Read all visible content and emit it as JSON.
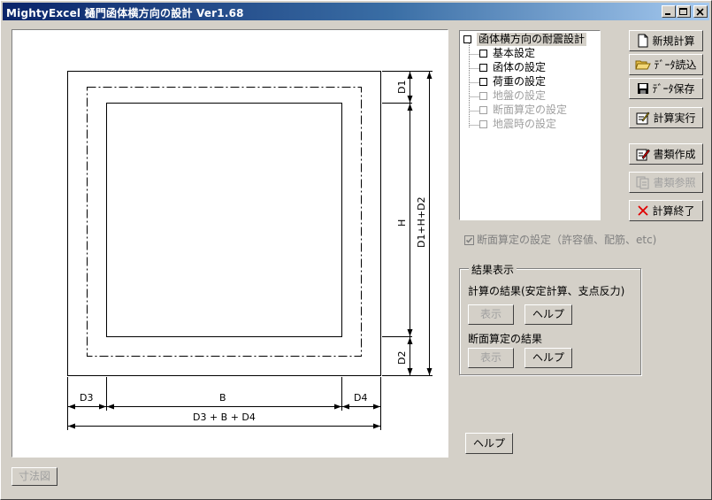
{
  "window": {
    "title": "MightyExcel 樋門函体横方向の設計  Ver1.68"
  },
  "diagram": {
    "labels": {
      "d1": "D1",
      "d2": "D2",
      "h": "H",
      "total_h": "D1+H+D2",
      "d3": "D3",
      "b": "B",
      "d4": "D4",
      "total_w": "D3 + B + D4"
    }
  },
  "tree": {
    "items": [
      {
        "label": "函体横方向の耐震設計",
        "enabled": true
      },
      {
        "label": "基本設定",
        "enabled": true
      },
      {
        "label": "函体の設定",
        "enabled": true
      },
      {
        "label": "荷重の設定",
        "enabled": true
      },
      {
        "label": "地盤の設定",
        "enabled": false
      },
      {
        "label": "断面算定の設定",
        "enabled": false
      },
      {
        "label": "地震時の設定",
        "enabled": false
      }
    ]
  },
  "buttons": {
    "new_calc": "新規計算",
    "load_data": "ﾃﾞｰﾀ読込",
    "save_data": "ﾃﾞｰﾀ保存",
    "run_calc": "計算実行",
    "make_doc": "書類作成",
    "view_doc": "書類参照",
    "end_calc": "計算終了",
    "help_main": "ヘルプ",
    "dimension_diagram": "寸法図"
  },
  "section_check": {
    "label": "断面算定の設定（許容値、配筋、etc)",
    "checked": true,
    "enabled": false
  },
  "results": {
    "title": "結果表示",
    "calc_label": "計算の結果(安定計算、支点反力)",
    "section_label": "断面算定の結果",
    "show": "表示",
    "help": "ヘルプ"
  }
}
